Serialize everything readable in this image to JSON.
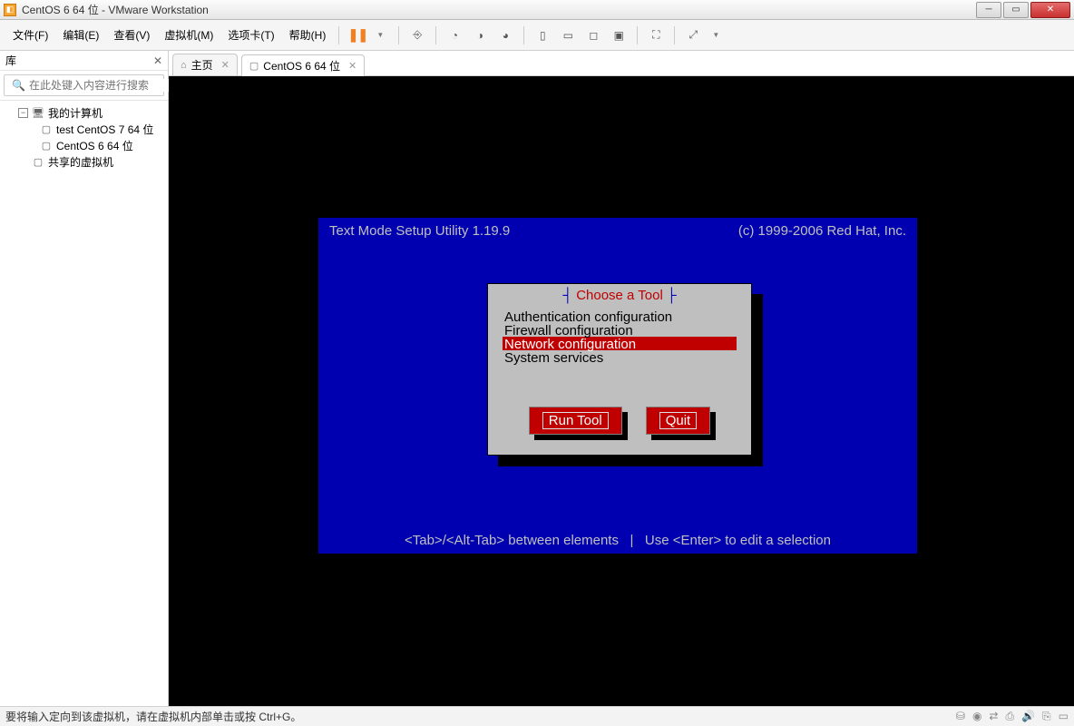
{
  "window": {
    "title": "CentOS 6 64 位 - VMware Workstation"
  },
  "menu": {
    "file": "文件(F)",
    "edit": "编辑(E)",
    "view": "查看(V)",
    "vm": "虚拟机(M)",
    "tabs": "选项卡(T)",
    "help": "帮助(H)"
  },
  "sidebar": {
    "title": "库",
    "search_placeholder": "在此处键入内容进行搜索",
    "root": "我的计算机",
    "items": [
      "test CentOS 7 64 位",
      "CentOS 6 64 位"
    ],
    "shared": "共享的虚拟机"
  },
  "tabs": {
    "home": "主页",
    "vm": "CentOS 6 64 位"
  },
  "tui": {
    "header_left": "Text Mode Setup Utility 1.19.9",
    "header_right": "(c) 1999-2006 Red Hat, Inc.",
    "dialog_title": "Choose a Tool",
    "options": [
      "Authentication configuration",
      "Firewall configuration",
      "Network configuration",
      "System services"
    ],
    "selected_index": 2,
    "run": "Run Tool",
    "quit": "Quit",
    "footer": "<Tab>/<Alt-Tab> between elements   |   Use <Enter> to edit a selection"
  },
  "statusbar": {
    "text": "要将输入定向到该虚拟机，请在虚拟机内部单击或按 Ctrl+G。"
  }
}
